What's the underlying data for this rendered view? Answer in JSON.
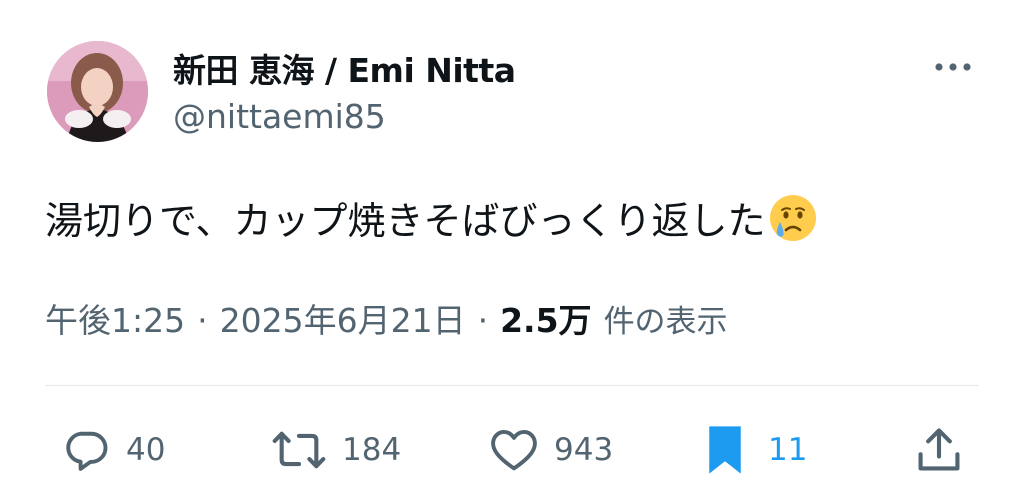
{
  "author": {
    "display_name": "新田 恵海 / Emi Nitta",
    "handle": "@nittaemi85"
  },
  "tweet": {
    "text": "湯切りで、カップ焼きそばびっくり返した",
    "emoji": "crying-face"
  },
  "meta": {
    "time": "午後1:25",
    "date": "2025年6月21日",
    "views_count": "2.5万",
    "views_label": "件の表示",
    "separator": "·"
  },
  "actions": {
    "replies": "40",
    "retweets": "184",
    "likes": "943",
    "bookmarks": "11"
  },
  "colors": {
    "text": "#0f1419",
    "secondary": "#536471",
    "accent": "#1d9bf0",
    "divider": "#e6e9ec"
  },
  "icons": [
    "more-icon",
    "reply-icon",
    "retweet-icon",
    "like-icon",
    "bookmark-icon",
    "share-icon"
  ]
}
